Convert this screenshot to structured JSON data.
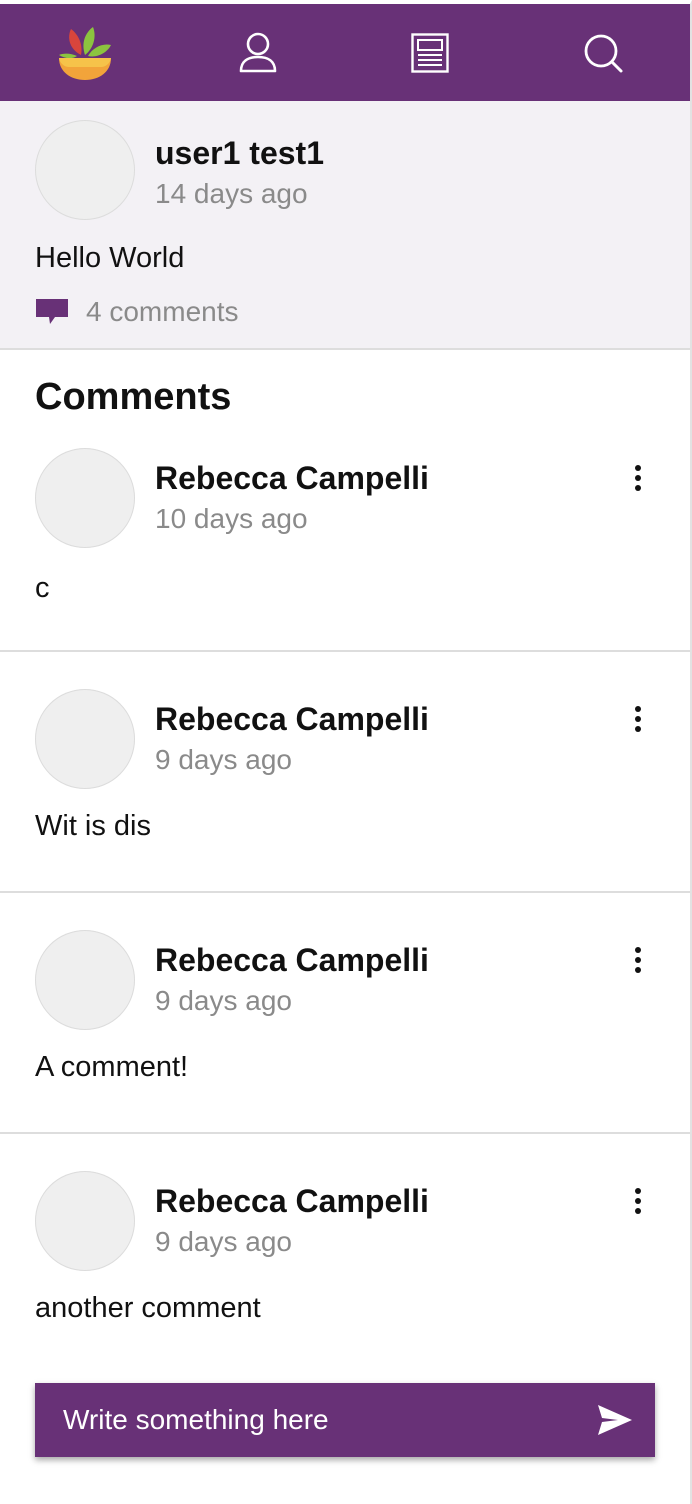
{
  "colors": {
    "brand_purple": "#683177",
    "post_background": "#f3f1f5",
    "muted_text": "#8a8a8a",
    "divider": "#dddddd"
  },
  "nav": {
    "items": [
      {
        "name": "logo",
        "icon": "app-logo-bowl-leaves-icon"
      },
      {
        "name": "profile",
        "icon": "person-icon"
      },
      {
        "name": "feed",
        "icon": "newspaper-icon"
      },
      {
        "name": "search",
        "icon": "search-icon"
      }
    ]
  },
  "post": {
    "author": "user1 test1",
    "time": "14 days ago",
    "text": "Hello World",
    "comment_count": "4 comments",
    "comment_icon": "speech-bubble-icon"
  },
  "comments_section": {
    "title": "Comments",
    "items": [
      {
        "author": "Rebecca Campelli",
        "time": "10 days ago",
        "text": "c",
        "menu_icon": "kebab-menu-icon"
      },
      {
        "author": "Rebecca Campelli",
        "time": "9 days ago",
        "text": "Wit is dis",
        "menu_icon": "kebab-menu-icon"
      },
      {
        "author": "Rebecca Campelli",
        "time": "9 days ago",
        "text": "A comment!",
        "menu_icon": "kebab-menu-icon"
      },
      {
        "author": "Rebecca Campelli",
        "time": "9 days ago",
        "text": "another comment",
        "menu_icon": "kebab-menu-icon"
      }
    ]
  },
  "composer": {
    "placeholder": "Write something here",
    "value": "",
    "send_icon": "send-arrow-icon"
  }
}
